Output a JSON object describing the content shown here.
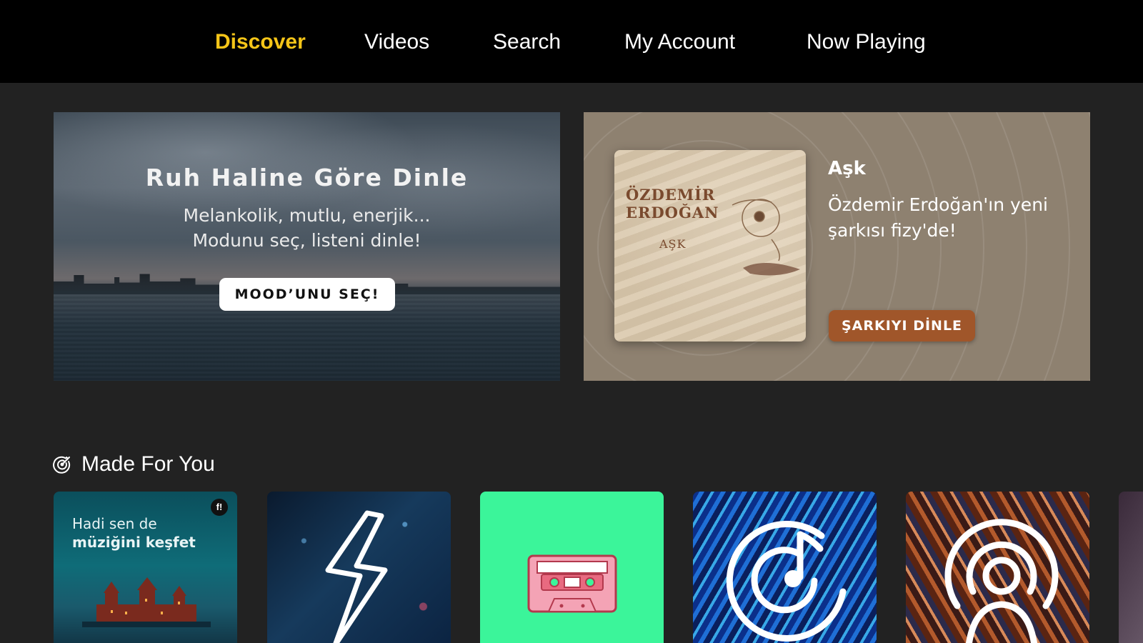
{
  "nav": {
    "items": [
      {
        "label": "Discover",
        "active": true
      },
      {
        "label": "Videos"
      },
      {
        "label": "Search"
      },
      {
        "label": "My Account"
      },
      {
        "label": "Now Playing"
      }
    ],
    "active_color": "#f5c518"
  },
  "banners": {
    "mood": {
      "title": "Ruh Haline Göre Dinle",
      "subtitle_line1": "Melankolik, mutlu, enerjik...",
      "subtitle_line2": "Modunu seç, listeni dinle!",
      "button": "MOOD’UNU SEÇ!"
    },
    "ask": {
      "album_artist": "ÖZDEMİR\nERDOĞAN",
      "album_title": "AŞK",
      "song_title": "Aşk",
      "description": "Özdemir Erdoğan'ın yeni şarkısı fizy'de!",
      "button": "ŞARKIYI DİNLE",
      "button_color": "#a0562a"
    }
  },
  "section": {
    "title": "Made For You",
    "icon": "target-icon"
  },
  "cards": {
    "card1": {
      "line1": "Hadi sen de",
      "line2": "müziğini keşfet",
      "badge": "f!"
    },
    "card2": {
      "icon": "lightning-icon"
    },
    "card3": {
      "icon": "cassette-icon",
      "color": "#3bf59a"
    },
    "card4": {
      "icon": "music-radar-icon"
    },
    "card5": {
      "icon": "artist-radio-icon"
    }
  }
}
